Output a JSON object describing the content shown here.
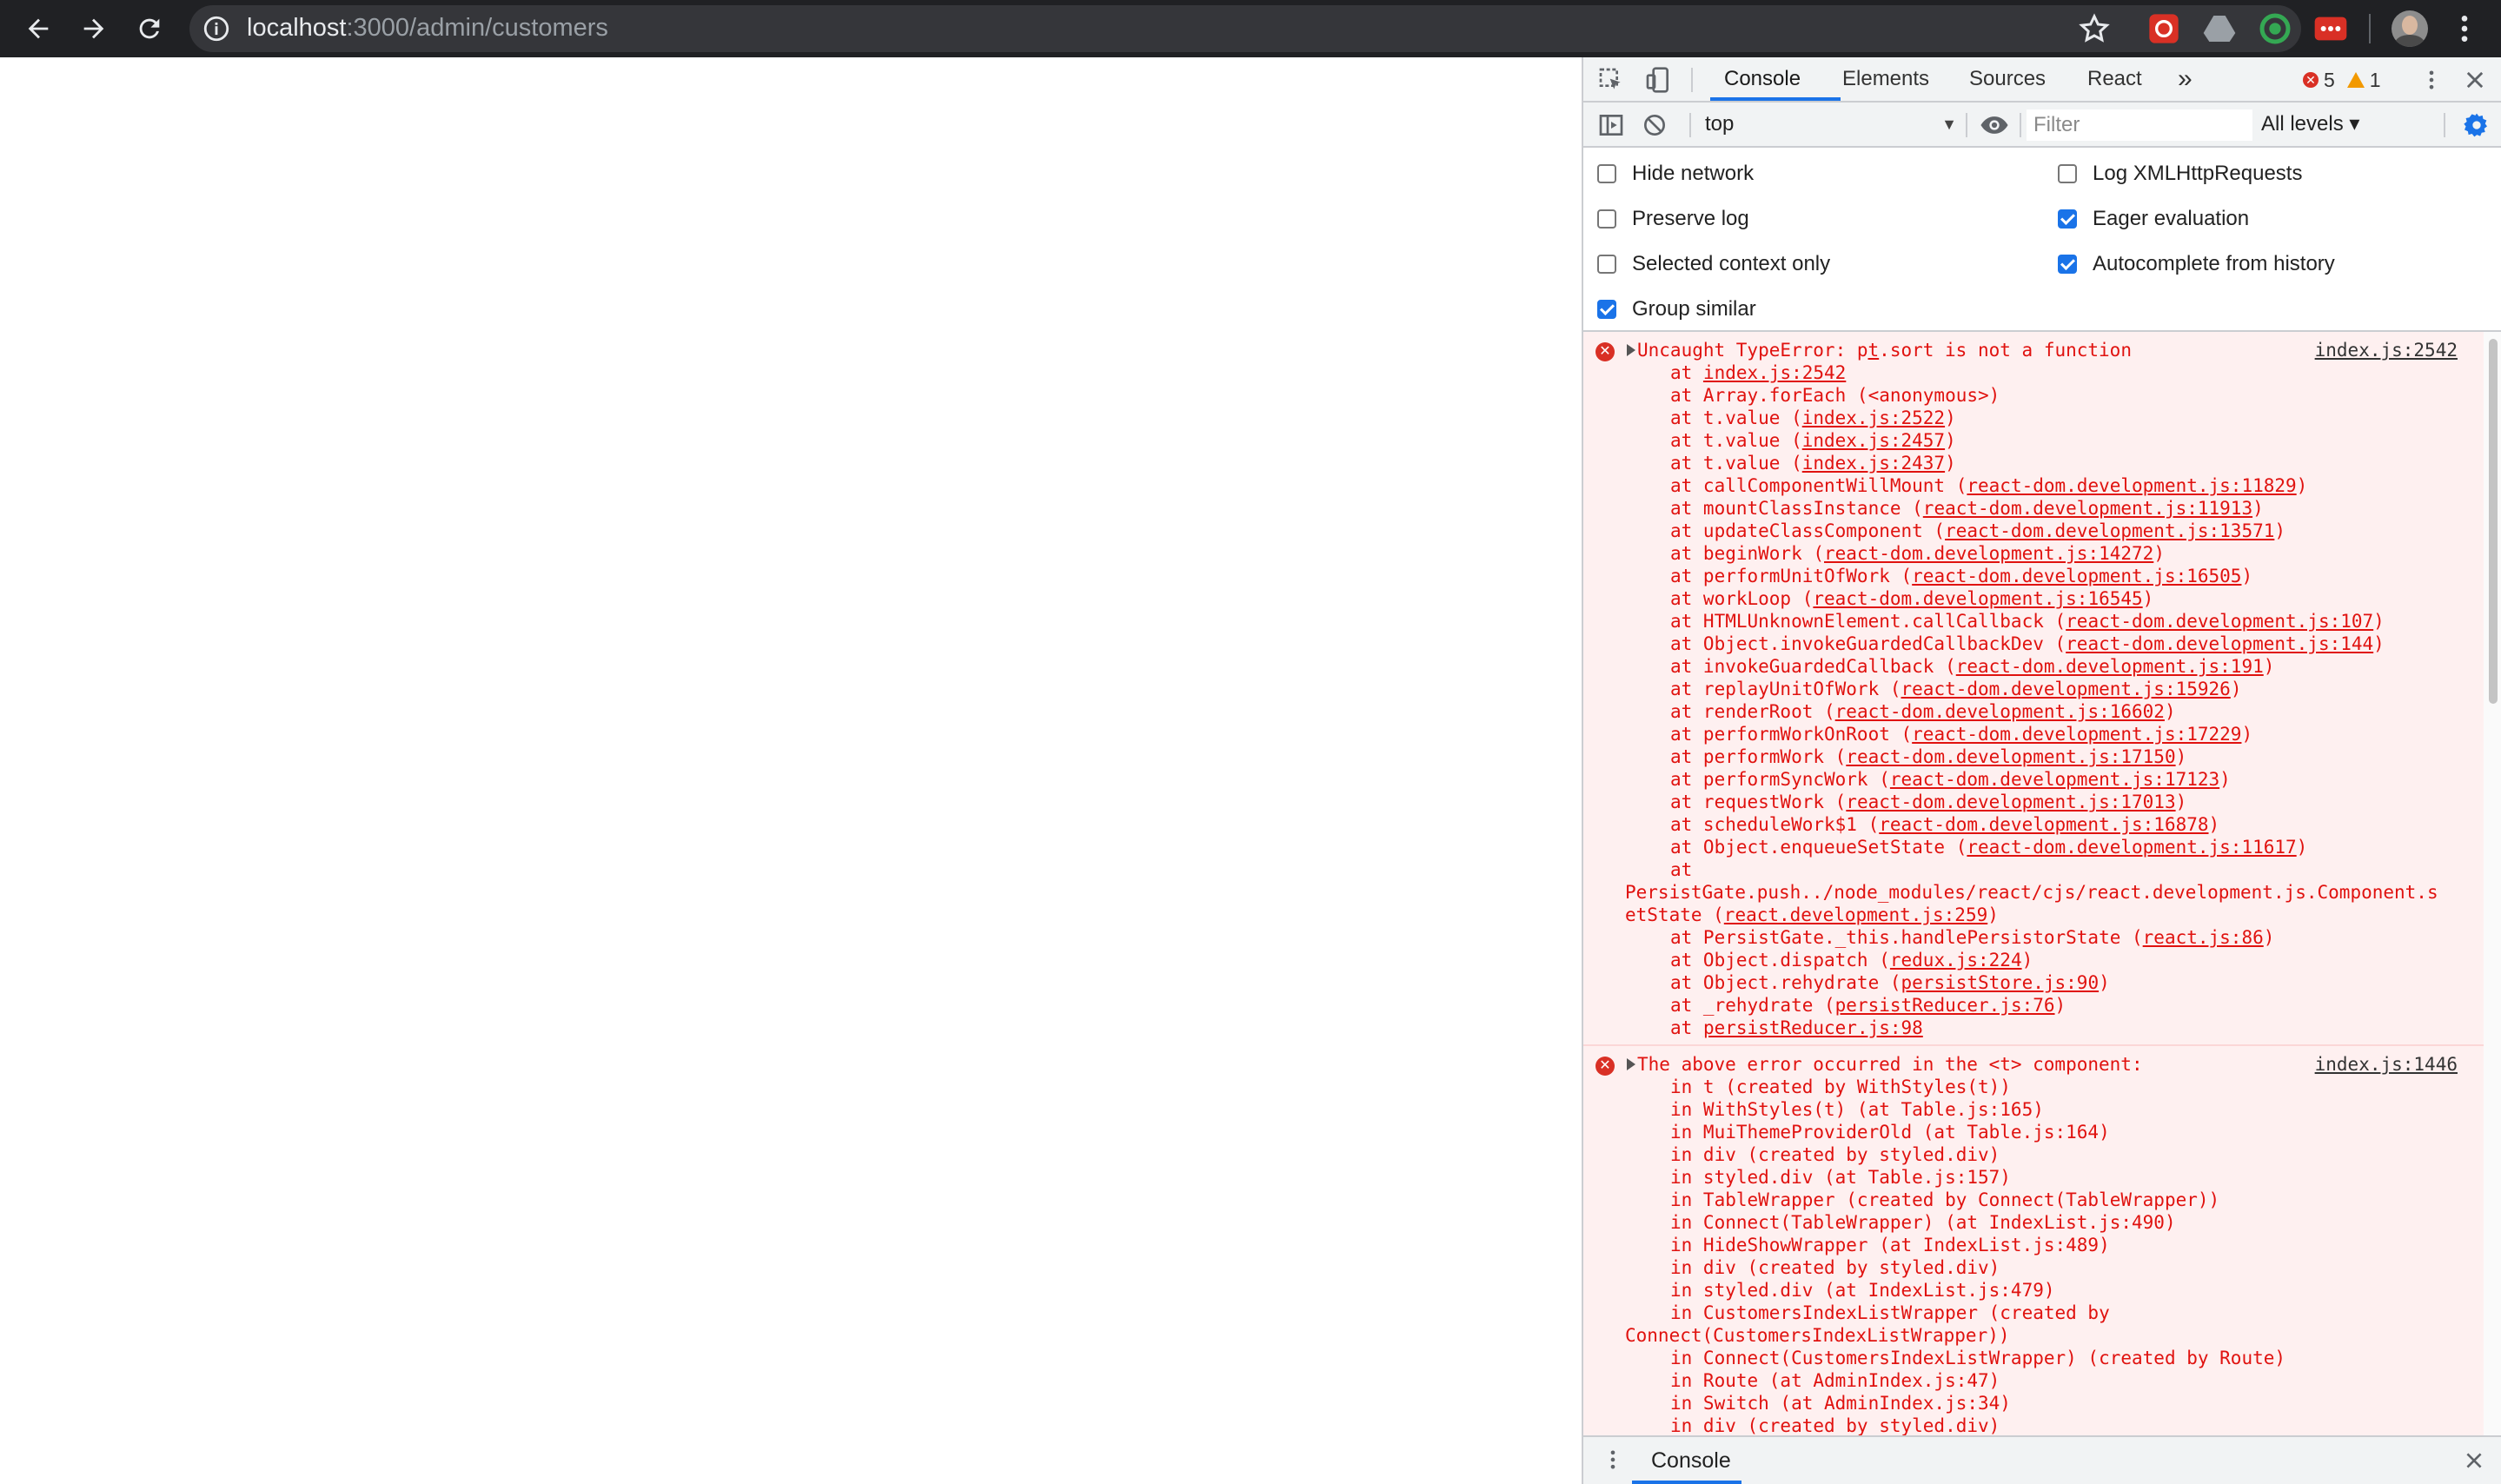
{
  "browser": {
    "url_host": "localhost",
    "url_path": ":3000/admin/customers"
  },
  "devtools": {
    "tabs": [
      {
        "label": "Console"
      },
      {
        "label": "Elements"
      },
      {
        "label": "Sources"
      },
      {
        "label": "React"
      }
    ],
    "more_tabs": "»",
    "error_count": "5",
    "warning_count": "1",
    "context": "top",
    "filter_placeholder": "Filter",
    "levels": "All levels ▾",
    "settings": [
      {
        "label": "Hide network",
        "checked": false
      },
      {
        "label": "Preserve log",
        "checked": false
      },
      {
        "label": "Selected context only",
        "checked": false
      },
      {
        "label": "Group similar",
        "checked": true
      },
      {
        "label": "Log XMLHttpRequests",
        "checked": false
      },
      {
        "label": "Eager evaluation",
        "checked": true
      },
      {
        "label": "Autocomplete from history",
        "checked": true
      }
    ],
    "messages": [
      {
        "source": "index.js:2542",
        "lines": [
          "Uncaught TypeError: p[t].sort is not a function",
          "at [index.js:2542]",
          "at Array.forEach (<anonymous>)",
          "at t.value ([index.js:2522])",
          "at t.value ([index.js:2457])",
          "at t.value ([index.js:2437])",
          "at callComponentWillMount ([react-dom.development.js:11829])",
          "at mountClassInstance ([react-dom.development.js:11913])",
          "at updateClassComponent ([react-dom.development.js:13571])",
          "at beginWork ([react-dom.development.js:14272])",
          "at performUnitOfWork ([react-dom.development.js:16505])",
          "at workLoop ([react-dom.development.js:16545])",
          "at HTMLUnknownElement.callCallback ([react-dom.development.js:107])",
          "at Object.invokeGuardedCallbackDev ([react-dom.development.js:144])",
          "at invokeGuardedCallback ([react-dom.development.js:191])",
          "at replayUnitOfWork ([react-dom.development.js:15926])",
          "at renderRoot ([react-dom.development.js:16602])",
          "at performWorkOnRoot ([react-dom.development.js:17229])",
          "at performWork ([react-dom.development.js:17150])",
          "at performSyncWork ([react-dom.development.js:17123])",
          "at requestWork ([react-dom.development.js:17013])",
          "at scheduleWork$1 ([react-dom.development.js:16878])",
          "at Object.enqueueSetState ([react-dom.development.js:11617])",
          "at",
          "^PersistGate.push../node_modules/react/cjs/react.development.js.Component.setState ([react.development.js:259])",
          "at PersistGate._this.handlePersistorState ([react.js:86])",
          "at Object.dispatch ([redux.js:224])",
          "at Object.rehydrate ([persistStore.js:90])",
          "at _rehydrate ([persistReducer.js:76])",
          "at [persistReducer.js:98]"
        ]
      },
      {
        "source": "index.js:1446",
        "lines": [
          "The above error occurred in the <t> component:",
          "in t (created by WithStyles(t))",
          "in WithStyles(t) (at Table.js:165)",
          "in MuiThemeProviderOld (at Table.js:164)",
          "in div (created by styled.div)",
          "in styled.div (at Table.js:157)",
          "in TableWrapper (created by Connect(TableWrapper))",
          "in Connect(TableWrapper) (at IndexList.js:490)",
          "in HideShowWrapper (at IndexList.js:489)",
          "in div (created by styled.div)",
          "in styled.div (at IndexList.js:479)",
          "in CustomersIndexListWrapper (created by",
          "^Connect(CustomersIndexListWrapper))",
          "in Connect(CustomersIndexListWrapper) (created by Route)",
          "in Route (at AdminIndex.js:47)",
          "in Switch (at AdminIndex.js:34)",
          "in div (created by styled.div)"
        ]
      }
    ],
    "drawer_tab": "Console"
  }
}
